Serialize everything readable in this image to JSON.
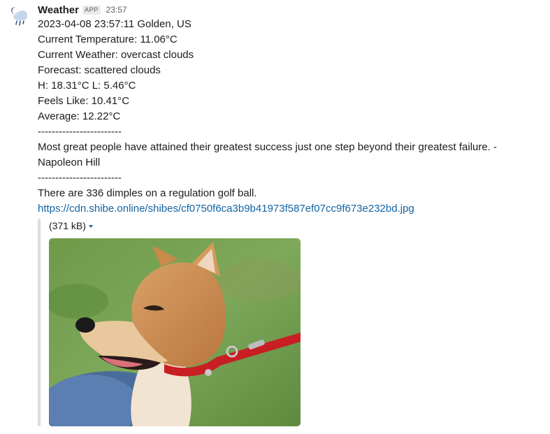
{
  "message": {
    "sender": "Weather",
    "badge": "APP",
    "time": "23:57",
    "lines": [
      "2023-04-08 23:57:11 Golden, US",
      "Current Temperature: 11.06°C",
      "Current Weather: overcast clouds",
      "Forecast: scattered clouds",
      "H: 18.31°C L: 5.46°C",
      "Feels Like: 10.41°C",
      "Average: 12.22°C",
      "------------------------",
      "Most great people have attained their greatest success just one step beyond their greatest failure. - Napoleon Hill",
      "------------------------",
      "There are 336 dimples on a regulation golf ball."
    ],
    "link": "https://cdn.shibe.online/shibes/cf0750f6ca3b9b41973f587ef07cc9f673e232bd.jpg"
  },
  "attachment": {
    "size": "(371 kB)",
    "image_icon": "shiba-inu-dog-photo"
  },
  "icons": {
    "avatar": "moon-cloud-rain-icon",
    "caret": "caret-down-icon"
  },
  "colors": {
    "link": "#1264a3",
    "text": "#1d1c1d",
    "muted": "#616061",
    "quote_bar": "#dddddd"
  }
}
